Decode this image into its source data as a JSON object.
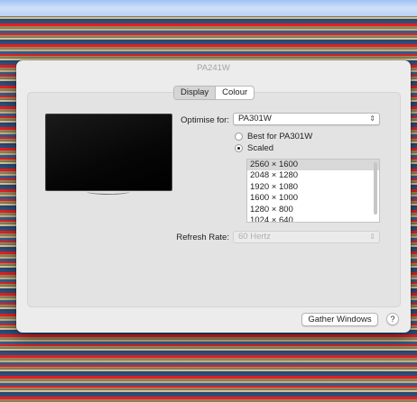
{
  "window": {
    "title": "PA241W"
  },
  "tabs": [
    {
      "label": "Display",
      "active": true
    },
    {
      "label": "Colour",
      "active": false
    }
  ],
  "optimise": {
    "label": "Optimise for:",
    "value": "PA301W"
  },
  "resolution_mode": {
    "options": [
      {
        "label": "Best for PA301W",
        "selected": false
      },
      {
        "label": "Scaled",
        "selected": true
      }
    ]
  },
  "resolutions": [
    {
      "label": "2560 × 1600",
      "selected": true
    },
    {
      "label": "2048 × 1280",
      "selected": false
    },
    {
      "label": "1920 × 1080",
      "selected": false
    },
    {
      "label": "1600 × 1000",
      "selected": false
    },
    {
      "label": "1280 × 800",
      "selected": false
    },
    {
      "label": "1024 × 640",
      "selected": false
    }
  ],
  "refresh": {
    "label": "Refresh Rate:",
    "value": "60 Hertz",
    "disabled": true
  },
  "buttons": {
    "gather": "Gather Windows",
    "help": "?"
  },
  "icons": {
    "chevron": "up-down-chevron-icon",
    "monitor": "display-monitor-icon"
  }
}
